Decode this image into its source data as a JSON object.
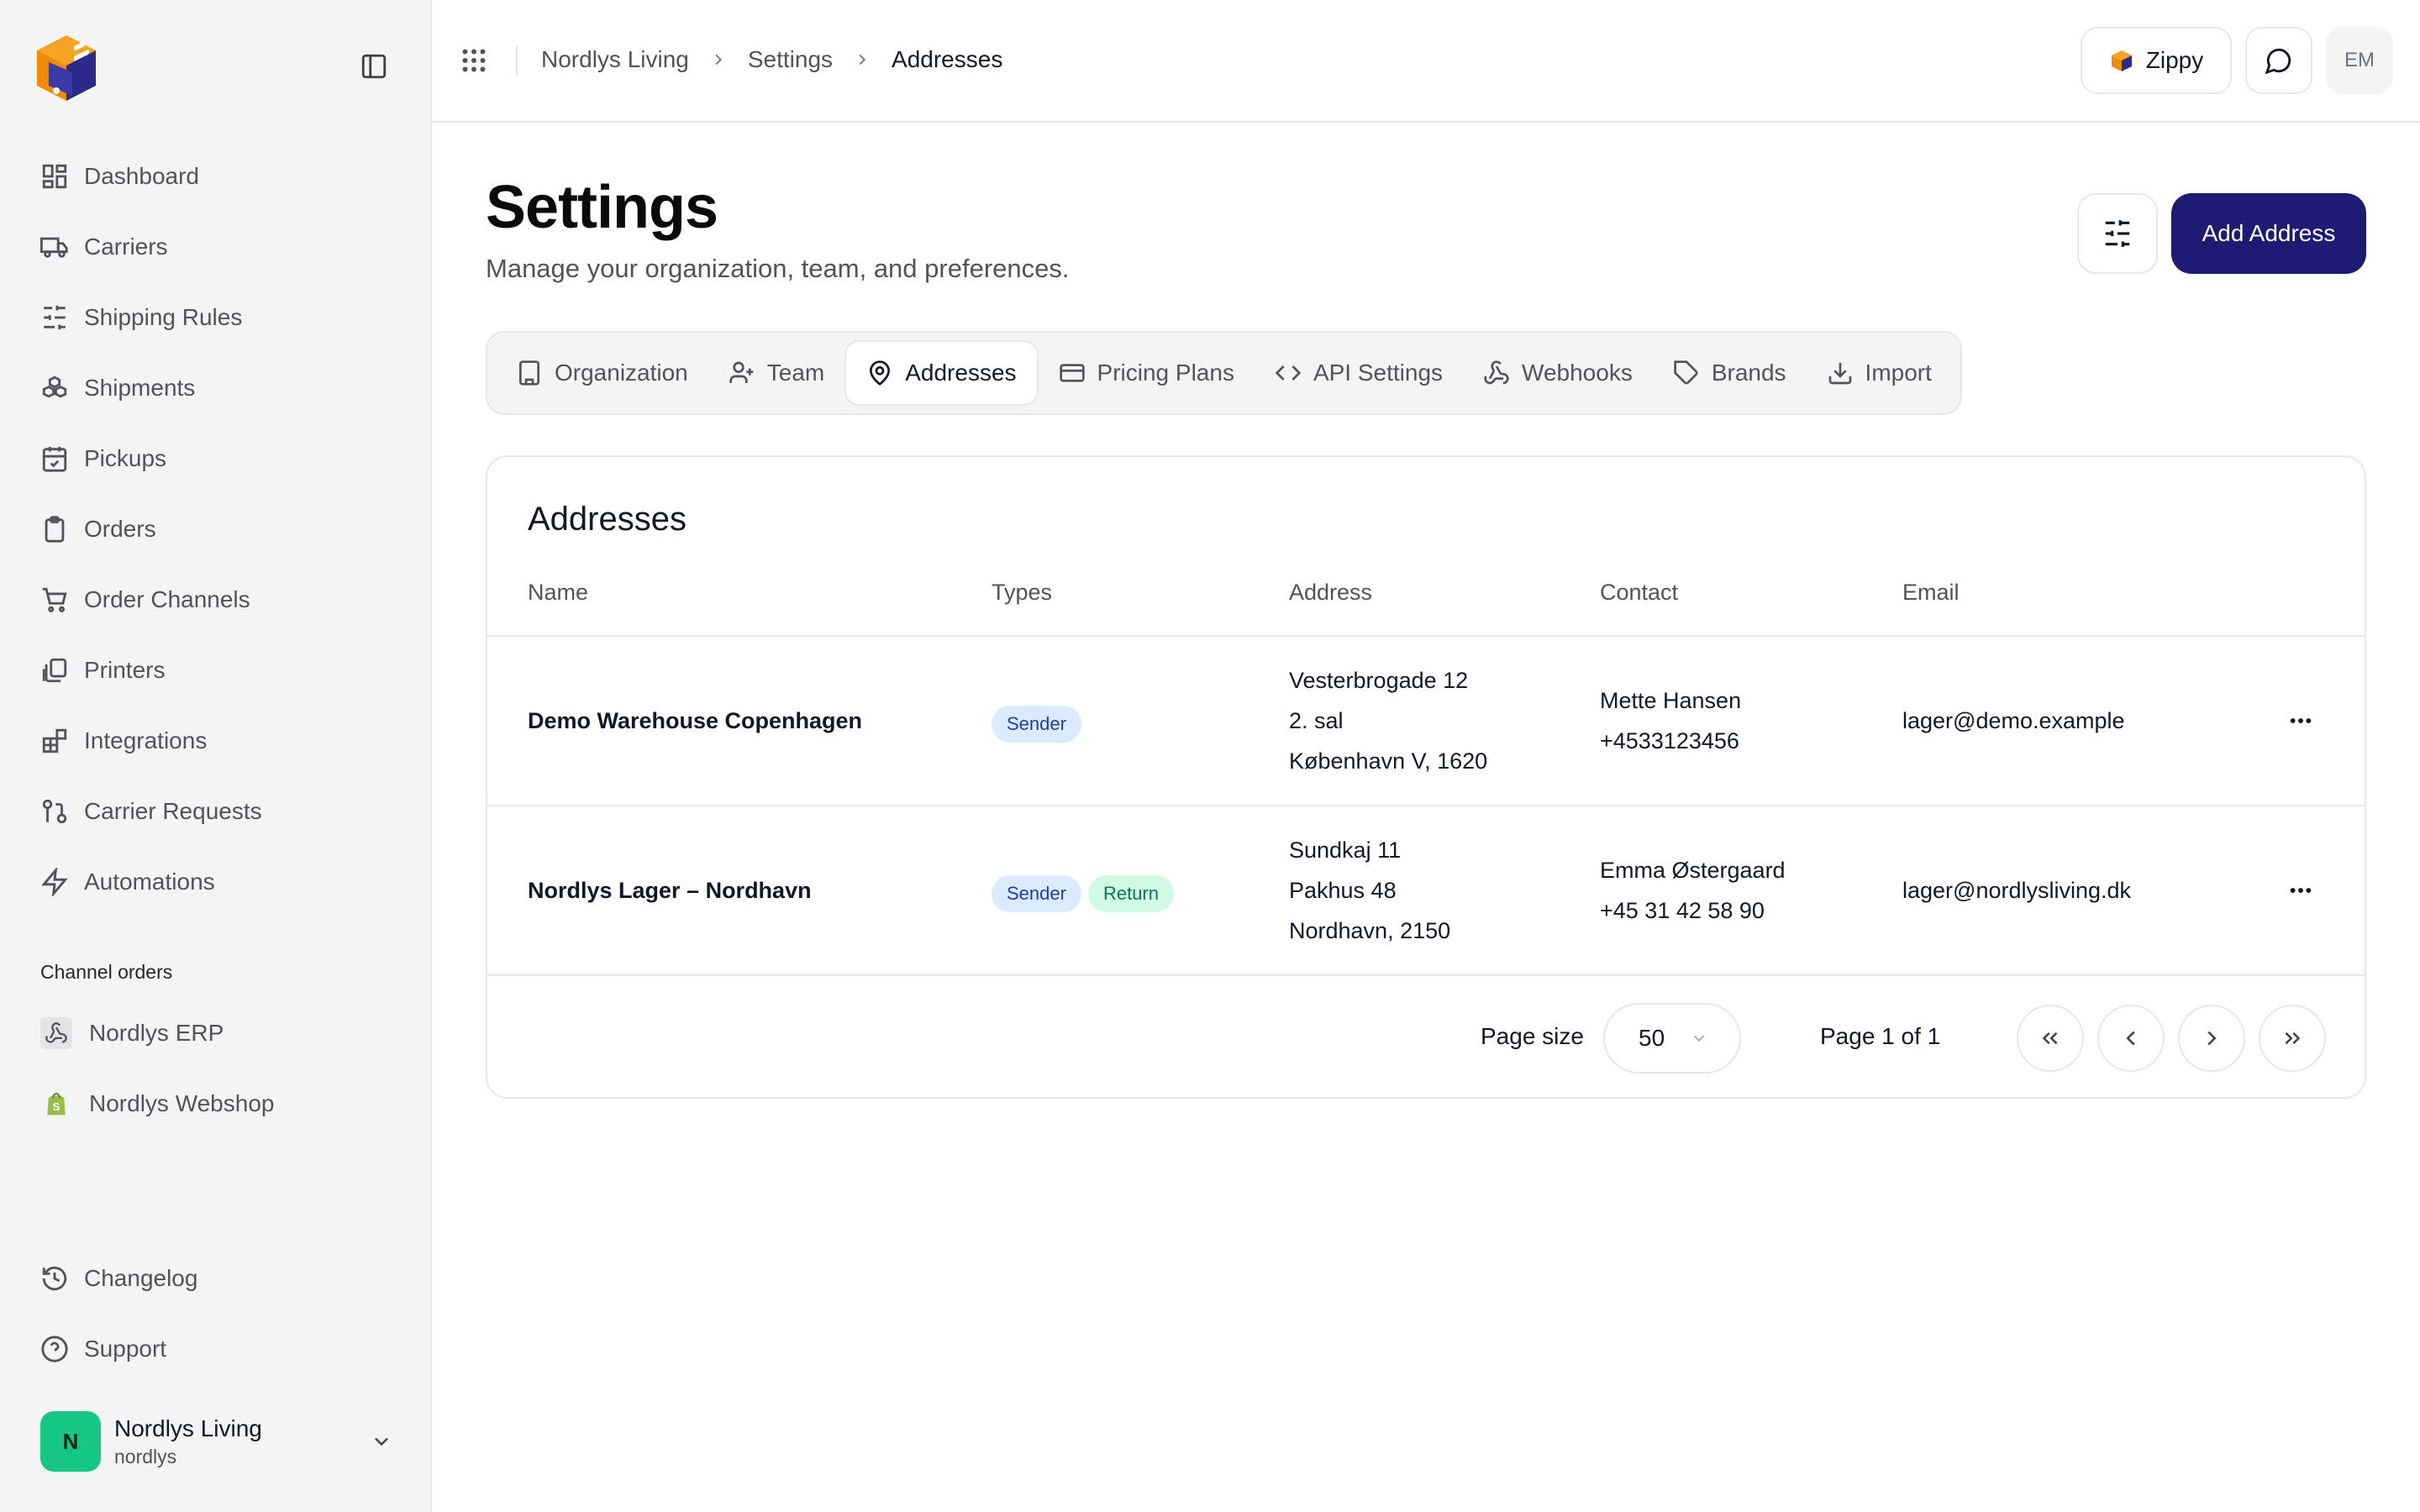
{
  "sidebar": {
    "nav": [
      {
        "label": "Dashboard",
        "icon": "dashboard-icon"
      },
      {
        "label": "Carriers",
        "icon": "truck-icon"
      },
      {
        "label": "Shipping Rules",
        "icon": "sliders-icon"
      },
      {
        "label": "Shipments",
        "icon": "boxes-icon"
      },
      {
        "label": "Pickups",
        "icon": "calendar-check-icon"
      },
      {
        "label": "Orders",
        "icon": "clipboard-icon"
      },
      {
        "label": "Order Channels",
        "icon": "cart-icon"
      },
      {
        "label": "Printers",
        "icon": "copy-icon"
      },
      {
        "label": "Integrations",
        "icon": "blocks-icon"
      },
      {
        "label": "Carrier Requests",
        "icon": "git-pull-request-icon"
      },
      {
        "label": "Automations",
        "icon": "zap-icon"
      }
    ],
    "channels_title": "Channel orders",
    "channels": [
      {
        "label": "Nordlys ERP",
        "icon": "webhook-icon"
      },
      {
        "label": "Nordlys Webshop",
        "icon": "shopify-icon"
      }
    ],
    "footer": [
      {
        "label": "Changelog",
        "icon": "history-icon"
      },
      {
        "label": "Support",
        "icon": "help-circle-icon"
      }
    ],
    "org": {
      "initial": "N",
      "name": "Nordlys Living",
      "slug": "nordlys"
    }
  },
  "topbar": {
    "breadcrumbs": [
      "Nordlys Living",
      "Settings",
      "Addresses"
    ],
    "zippy_label": "Zippy",
    "avatar_initials": "EM"
  },
  "page": {
    "title": "Settings",
    "subtitle": "Manage your organization, team, and preferences.",
    "add_button": "Add Address"
  },
  "tabs": [
    {
      "label": "Organization",
      "icon": "building-icon",
      "active": false
    },
    {
      "label": "Team",
      "icon": "user-plus-icon",
      "active": false
    },
    {
      "label": "Addresses",
      "icon": "map-pin-icon",
      "active": true
    },
    {
      "label": "Pricing Plans",
      "icon": "credit-card-icon",
      "active": false
    },
    {
      "label": "API Settings",
      "icon": "code-icon",
      "active": false
    },
    {
      "label": "Webhooks",
      "icon": "webhook-icon",
      "active": false
    },
    {
      "label": "Brands",
      "icon": "tag-icon",
      "active": false
    },
    {
      "label": "Import",
      "icon": "download-icon",
      "active": false
    }
  ],
  "addresses": {
    "title": "Addresses",
    "columns": [
      "Name",
      "Types",
      "Address",
      "Contact",
      "Email"
    ],
    "rows": [
      {
        "name": "Demo Warehouse Copenhagen",
        "types": [
          "Sender"
        ],
        "address": [
          "Vesterbrogade 12",
          "2. sal",
          "København V, 1620"
        ],
        "contact": [
          "Mette Hansen",
          "+4533123456"
        ],
        "email": "lager@demo.example"
      },
      {
        "name": "Nordlys Lager – Nordhavn",
        "types": [
          "Sender",
          "Return"
        ],
        "address": [
          "Sundkaj 11",
          "Pakhus 48",
          "Nordhavn, 2150"
        ],
        "contact": [
          "Emma Østergaard",
          "+45 31 42 58 90"
        ],
        "email": "lager@nordlysliving.dk"
      }
    ],
    "pagination": {
      "page_size_label": "Page size",
      "page_size": "50",
      "page_text": "Page 1 of 1"
    }
  },
  "colors": {
    "primary": "#1e1b74",
    "sender_badge": "#dbeafe",
    "return_badge": "#d1fae5",
    "avatar_green": "#16c784"
  }
}
